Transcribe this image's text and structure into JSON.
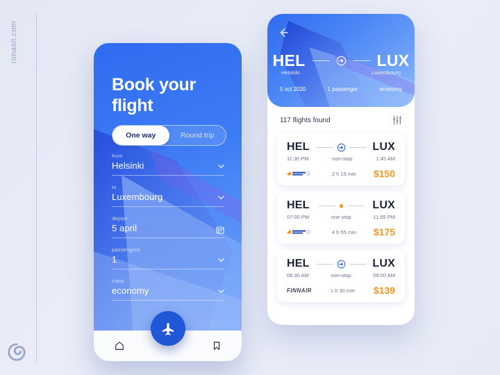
{
  "canvas": {
    "watermark": "ronasit.com",
    "background_color": "#e8ebf5",
    "accent_blue": "#2f6bf0",
    "accent_orange": "#f7941e"
  },
  "left_phone": {
    "title": "Book your flight",
    "trip_toggle": {
      "one_way": "One way",
      "round_trip": "Round trip",
      "selected": "One way"
    },
    "fields": [
      {
        "label": "from",
        "value": "Helsinki",
        "icon": "chevron-down-icon"
      },
      {
        "label": "to",
        "value": "Luxembourg",
        "icon": "chevron-down-icon"
      },
      {
        "label": "depart",
        "value": "5 april",
        "icon": "calendar-icon"
      },
      {
        "label": "passengers",
        "value": "1",
        "icon": "chevron-down-icon"
      },
      {
        "label": "class",
        "value": "economy",
        "icon": "chevron-down-icon"
      }
    ],
    "nav": {
      "home": "home-icon",
      "search_action": "plane-icon",
      "bookmark": "bookmark-icon"
    }
  },
  "right_phone": {
    "hero": {
      "back": "back-arrow-icon",
      "origin_code": "HEL",
      "origin_city": "Helsinki",
      "dest_code": "LUX",
      "dest_city": "Luxembourg",
      "route_icon": "plane-circle-icon",
      "date": "5 oct 2020",
      "passengers": "1 passenger",
      "class": "economy"
    },
    "results": {
      "count_label": "117 flights found",
      "filter_icon": "filter-sliders-icon"
    },
    "flights": [
      {
        "origin_code": "HEL",
        "dest_code": "LUX",
        "depart_time": "11:30 PM",
        "arrive_time": "1:45 AM",
        "stops_label": "non-stop",
        "stops_type": "nonstop",
        "duration": "2 h 15 min",
        "price": "$150",
        "airline": "czech-airlines-logo"
      },
      {
        "origin_code": "HEL",
        "dest_code": "LUX",
        "depart_time": "07:00 PM",
        "arrive_time": "11:55 PM",
        "stops_label": "one stop",
        "stops_type": "onestop",
        "duration": "4 h 55 min",
        "price": "$175",
        "airline": "czech-airlines-logo"
      },
      {
        "origin_code": "HEL",
        "dest_code": "LUX",
        "depart_time": "06:30 AM",
        "arrive_time": "08:00 AM",
        "stops_label": "non-stop",
        "stops_type": "nonstop",
        "duration": "1 h 30 min",
        "price": "$139",
        "airline": "FINNAIR"
      }
    ]
  }
}
